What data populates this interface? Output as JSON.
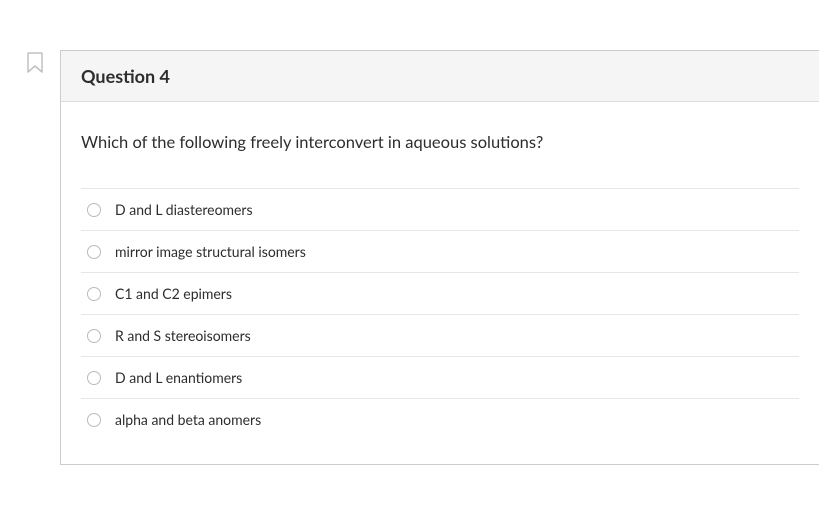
{
  "question": {
    "title": "Question 4",
    "prompt": "Which of the following freely interconvert in aqueous solutions?",
    "options": [
      {
        "label": "D and L diastereomers"
      },
      {
        "label": "mirror image structural isomers"
      },
      {
        "label": "C1 and C2 epimers"
      },
      {
        "label": "R and S stereoisomers"
      },
      {
        "label": "D and L enantiomers"
      },
      {
        "label": "alpha and beta anomers"
      }
    ]
  }
}
